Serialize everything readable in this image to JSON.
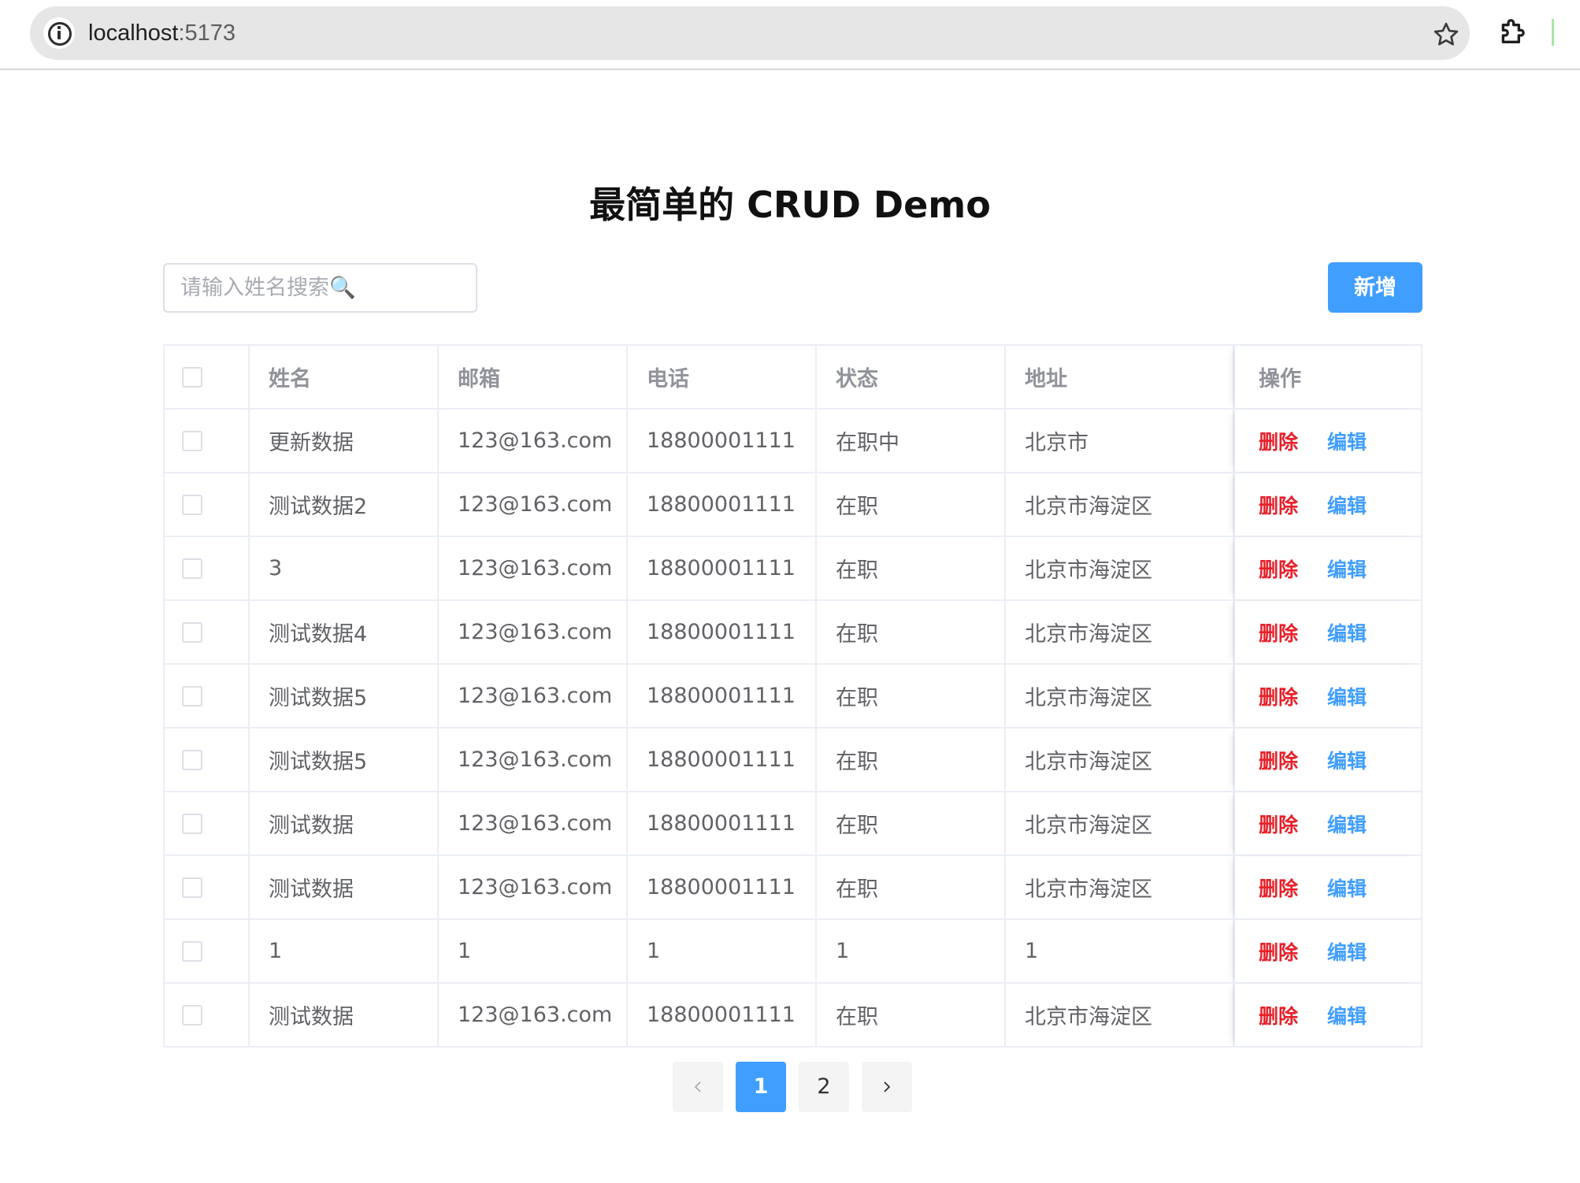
{
  "browser": {
    "url_host": "localhost",
    "url_port": ":5173"
  },
  "page": {
    "title": "最简单的 CRUD Demo"
  },
  "toolbar": {
    "search_placeholder": "请输入姓名搜索🔍",
    "add_label": "新增"
  },
  "table": {
    "columns": [
      "姓名",
      "邮箱",
      "电话",
      "状态",
      "地址",
      "操作"
    ],
    "rows": [
      {
        "name": "更新数据",
        "email": "123@163.com",
        "phone": "18800001111",
        "status": "在职中",
        "address": "北京市"
      },
      {
        "name": "测试数据2",
        "email": "123@163.com",
        "phone": "18800001111",
        "status": "在职",
        "address": "北京市海淀区"
      },
      {
        "name": "3",
        "email": "123@163.com",
        "phone": "18800001111",
        "status": "在职",
        "address": "北京市海淀区"
      },
      {
        "name": "测试数据4",
        "email": "123@163.com",
        "phone": "18800001111",
        "status": "在职",
        "address": "北京市海淀区"
      },
      {
        "name": "测试数据5",
        "email": "123@163.com",
        "phone": "18800001111",
        "status": "在职",
        "address": "北京市海淀区"
      },
      {
        "name": "测试数据5",
        "email": "123@163.com",
        "phone": "18800001111",
        "status": "在职",
        "address": "北京市海淀区"
      },
      {
        "name": "测试数据",
        "email": "123@163.com",
        "phone": "18800001111",
        "status": "在职",
        "address": "北京市海淀区"
      },
      {
        "name": "测试数据",
        "email": "123@163.com",
        "phone": "18800001111",
        "status": "在职",
        "address": "北京市海淀区"
      },
      {
        "name": "1",
        "email": "1",
        "phone": "1",
        "status": "1",
        "address": "1"
      },
      {
        "name": "测试数据",
        "email": "123@163.com",
        "phone": "18800001111",
        "status": "在职",
        "address": "北京市海淀区"
      }
    ],
    "delete_label": "删除",
    "edit_label": "编辑"
  },
  "pagination": {
    "pages": [
      "1",
      "2"
    ],
    "current": "1"
  },
  "icons": {
    "site_info": "info-icon",
    "bookmark": "star-icon",
    "extensions": "puzzle-icon",
    "prev": "chevron-left-icon",
    "next": "chevron-right-icon"
  },
  "colors": {
    "primary": "#409eff",
    "danger": "#e8202a",
    "text": "#606266",
    "header_text": "#909399",
    "border": "#ebeef5"
  }
}
